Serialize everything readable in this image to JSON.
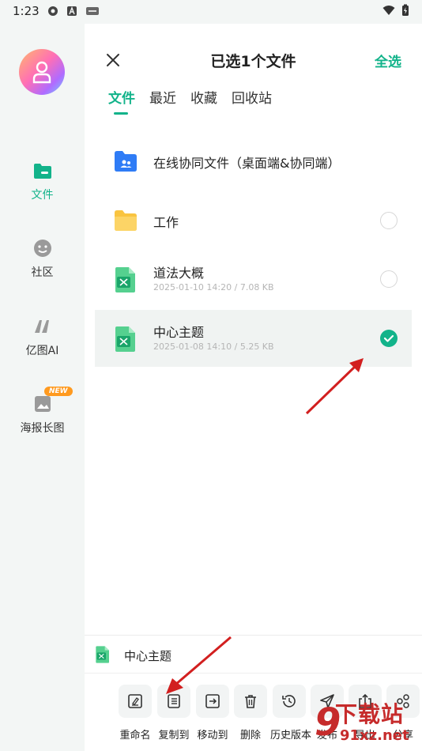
{
  "status_bar": {
    "time": "1:23"
  },
  "sidebar": {
    "items": [
      {
        "label": "文件",
        "icon": "folder-icon"
      },
      {
        "label": "社区",
        "icon": "community-icon"
      },
      {
        "label": "亿图AI",
        "icon": "ai-icon"
      },
      {
        "label": "海报长图",
        "icon": "poster-icon",
        "badge": "NEW"
      }
    ]
  },
  "header": {
    "title": "已选1个文件",
    "select_all": "全选"
  },
  "tabs": [
    "文件",
    "最近",
    "收藏",
    "回收站"
  ],
  "files": [
    {
      "name": "在线协同文件（桌面端&协同端）",
      "meta": "",
      "type": "shared-folder"
    },
    {
      "name": "工作",
      "meta": "",
      "type": "folder",
      "checked": false
    },
    {
      "name": "道法大概",
      "meta": "2025-01-10 14:20 / 7.08 KB",
      "type": "mindmap",
      "checked": false
    },
    {
      "name": "中心主题",
      "meta": "2025-01-08 14:10 / 5.25 KB",
      "type": "mindmap",
      "checked": true
    }
  ],
  "selected_file": {
    "name": "中心主题"
  },
  "toolbar": {
    "actions": [
      {
        "label": "重命名",
        "icon": "rename-icon"
      },
      {
        "label": "复制到",
        "icon": "copy-to-icon"
      },
      {
        "label": "移动到",
        "icon": "move-to-icon"
      },
      {
        "label": "删除",
        "icon": "trash-icon"
      },
      {
        "label": "历史版本",
        "icon": "history-icon"
      },
      {
        "label": "发布",
        "icon": "publish-icon"
      },
      {
        "label": "导出",
        "icon": "export-icon"
      },
      {
        "label": "分享",
        "icon": "share-icon"
      }
    ]
  },
  "watermark": {
    "num": "9",
    "text": "下载站",
    "url": "91xz.net"
  },
  "colors": {
    "accent": "#12b38a",
    "sidebar_bg": "#f3f6f5",
    "arrow": "#d21f1f"
  }
}
